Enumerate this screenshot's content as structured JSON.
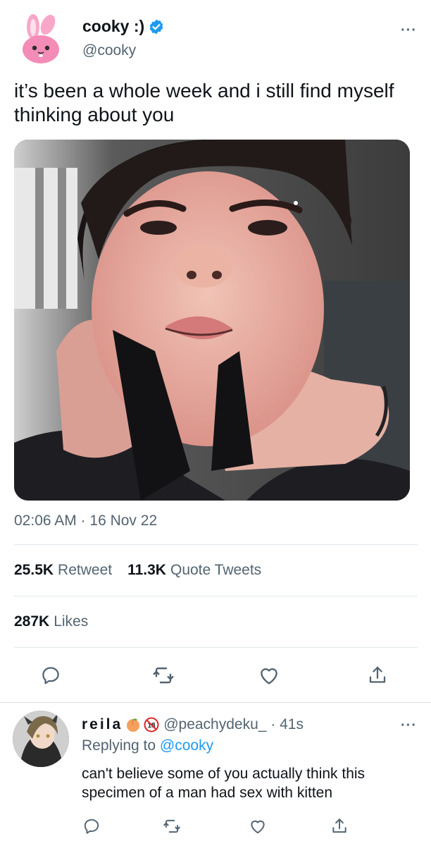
{
  "tweet": {
    "author_name": "cooky :)",
    "author_handle": "@cooky",
    "text": "it’s been a whole week and i still find myself thinking about you",
    "timestamp": "02:06 AM · 16 Nov 22",
    "retweets_count": "25.5K",
    "retweets_label": "Retweet",
    "quotes_count": "11.3K",
    "quotes_label": "Quote Tweets",
    "likes_count": "287K",
    "likes_label": "Likes",
    "more_icon": "···"
  },
  "actions": [
    "reply-icon",
    "retweet-icon",
    "like-icon",
    "share-icon"
  ],
  "reply": {
    "name": "reila",
    "handle_time": "@peachydeku_ · 41s",
    "replying_prefix": "Replying to",
    "replying_to": "@cooky",
    "text": "can't believe some of you actually think this specimen of a man had sex with kitten",
    "badge_text": "18",
    "more_icon": "···"
  },
  "colors": {
    "accent": "#1d9bf0",
    "secondary_text": "#536471",
    "primary_text": "#0f1419",
    "divider": "#e1e6ea"
  }
}
